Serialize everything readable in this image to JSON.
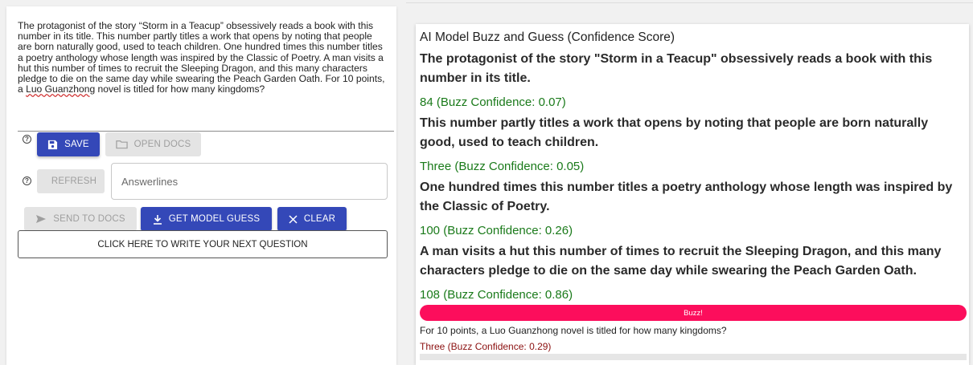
{
  "question": {
    "text_main": "The protagonist of the story “Storm in a Teacup” obsessively reads a book with this number in its title. This number partly titles a work that opens by noting that people are born naturally good, used to teach children. One hundred times this number titles a poetry anthology whose length was inspired by the Classic of Poetry. A man visits a hut this number of times to recruit the Sleeping Dragon, and this many characters pledge to die on the same day while swearing the Peach Garden Oath. For 10 points, a ",
    "text_squiggle": "Luo Guanzhong",
    "text_end": " novel is titled for how many kingdoms?"
  },
  "toolbar": {
    "help_glyph": "?",
    "save_label": "Save",
    "open_docs_label": "Open Docs",
    "refresh_label": "Refresh",
    "send_to_docs_label": "Send to Docs",
    "get_model_guess_label": "Get Model Guess",
    "clear_label": "Clear",
    "write_next_label": "Click here to write your next question"
  },
  "answerlines": {
    "placeholder": "Answerlines",
    "value": ""
  },
  "model_panel": {
    "title": "AI Model Buzz and Guess (Confidence Score)",
    "clues": [
      {
        "text": "The protagonist of the story \"Storm in a Teacup\" obsessively reads a book with this number in its title.",
        "guess": "84 (Buzz Confidence: 0.07)"
      },
      {
        "text": "This number partly titles a work that opens by noting that people are born naturally good, used to teach children.",
        "guess": "Three (Buzz Confidence: 0.05)"
      },
      {
        "text": "One hundred times this number titles a poetry anthology whose length was inspired by the Classic of Poetry.",
        "guess": "100 (Buzz Confidence: 0.26)"
      },
      {
        "text": "A man visits a hut this number of times to recruit the Sleeping Dragon, and this many characters pledge to die on the same day while swearing the Peach Garden Oath.",
        "guess": "108 (Buzz Confidence: 0.86)"
      }
    ],
    "buzz_label": "Buzz!",
    "final_clue": "For 10 points, a Luo Guanzhong novel is titled for how many kingdoms?",
    "final_guess": "Three (Buzz Confidence: 0.29)"
  },
  "colors": {
    "primary": "#3448b8",
    "buzz": "#fc0e5c",
    "guess_green": "#1a7a1a",
    "final_guess_red": "#8b1010"
  }
}
